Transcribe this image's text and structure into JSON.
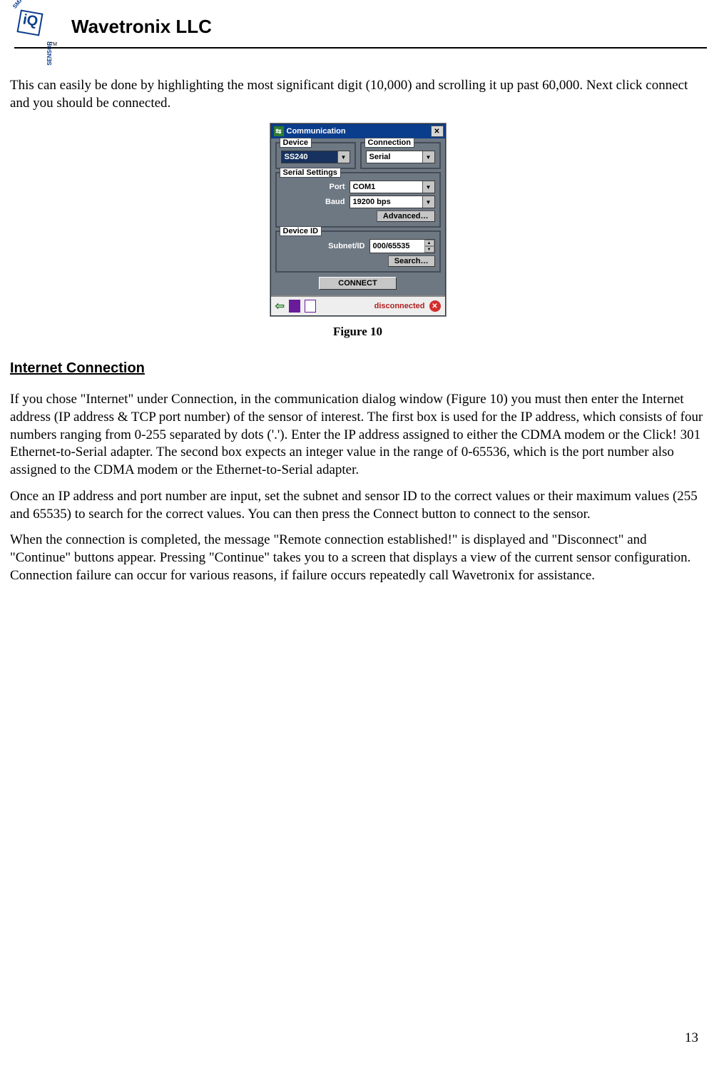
{
  "header": {
    "company": "Wavetronix LLC",
    "logo": {
      "smart": "SMART",
      "iq": "iQ",
      "sensor": "SENSOR",
      "tm": "TM"
    }
  },
  "intro_paragraph": "This can easily be done by highlighting the most significant digit (10,000) and scrolling it up past 60,000.  Next click connect and you should be connected.",
  "dialog": {
    "title": "Communication",
    "device_group": "Device",
    "device_value": "SS240",
    "connection_group": "Connection",
    "connection_value": "Serial",
    "serial_group": "Serial Settings",
    "port_label": "Port",
    "port_value": "COM1",
    "baud_label": "Baud",
    "baud_value": "19200 bps",
    "advanced_btn": "Advanced…",
    "deviceid_group": "Device ID",
    "subnet_label": "Subnet/ID",
    "subnet_value": "000/65535",
    "search_btn": "Search…",
    "connect_btn": "CONNECT",
    "status_text": "disconnected"
  },
  "figure_caption": "Figure 10",
  "section_heading": "Internet Connection",
  "para1": "If you chose \"Internet\" under Connection, in the communication dialog window (Figure 10) you must then enter the Internet address (IP address & TCP port number) of the sensor of interest.  The first box is used for the IP address, which consists of four numbers ranging from 0-255 separated by dots ('.').  Enter the IP address assigned to either the CDMA modem or the Click! 301 Ethernet-to-Serial adapter.  The second box expects an integer value in the range of 0-65536, which is the port number also assigned to the CDMA modem or the Ethernet-to-Serial adapter.",
  "para2": "Once an IP address and port number are input, set the subnet and sensor ID to the correct values or their maximum values (255 and 65535) to search for the correct values.  You can then press the Connect button to connect to the sensor.",
  "para3": "When the connection is completed, the message \"Remote connection established!\" is displayed and \"Disconnect\" and \"Continue\" buttons appear. Pressing \"Continue\" takes you to a screen that displays a view of the current sensor configuration.  Connection failure can occur for various reasons, if failure occurs repeatedly call Wavetronix for assistance.",
  "page_number": "13"
}
